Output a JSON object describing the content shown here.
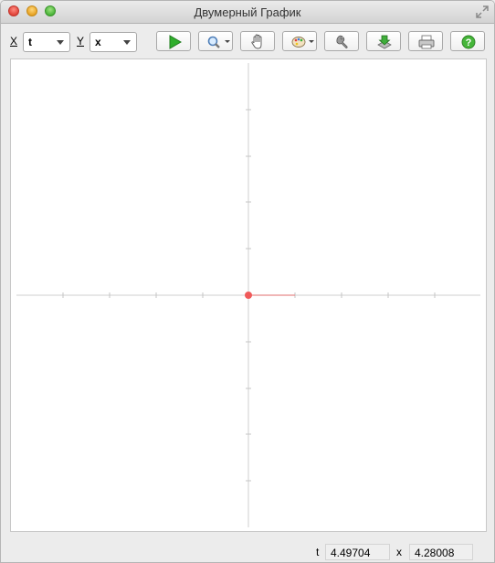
{
  "window": {
    "title": "Двумерный График"
  },
  "toolbar": {
    "x_label": "X",
    "x_value": "t",
    "y_label": "Y",
    "y_value": "x",
    "buttons": [
      {
        "name": "run",
        "icon": "play-icon"
      },
      {
        "name": "zoom",
        "icon": "magnifier-icon"
      },
      {
        "name": "pan",
        "icon": "hand-icon"
      },
      {
        "name": "colors",
        "icon": "palette-icon"
      },
      {
        "name": "settings",
        "icon": "wrench-icon"
      },
      {
        "name": "export",
        "icon": "export-icon"
      },
      {
        "name": "print",
        "icon": "printer-icon"
      },
      {
        "name": "help",
        "icon": "help-icon"
      }
    ]
  },
  "status": {
    "x_name": "t",
    "x_value": "4.49704",
    "y_name": "x",
    "y_value": "4.28008"
  },
  "colors": {
    "accent_play": "#2fae2c",
    "point": "#f05a5a",
    "axis": "#c9c9c9"
  }
}
